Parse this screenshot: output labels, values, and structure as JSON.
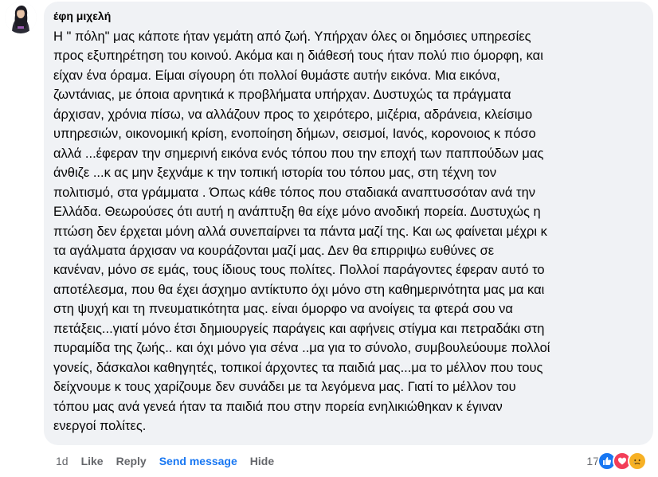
{
  "comment": {
    "author": "έφη μιχελή",
    "text": "Η \" πόλη\" μας κάποτε ήταν γεμάτη από ζωή. Υπήρχαν όλες οι δημόσιες υπηρεσίες\nπρος εξυπηρέτηση του κοινού. Ακόμα και η διάθεσή τους ήταν πολύ πιο όμορφη, και\nείχαν ένα όραμα. Είμαι σίγουρη ότι πολλοί θυμάστε αυτήν εικόνα. Μια εικόνα,\nζωντάνιας, με όποια αρνητικά κ προβλήματα υπήρχαν. Δυστυχώς τα πράγματα\nάρχισαν, χρόνια πίσω, να αλλάζουν προς το χειρότερο, μιζέρια, αδράνεια, κλείσιμο\nυπηρεσιών, οικονομική κρίση, ενοποίηση δήμων, σεισμοί, Ιανός, κορονοιος κ πόσο\nαλλά ...έφεραν την σημερινή εικόνα ενός τόπου που την εποχή των παππούδων μας\nάνθιζε ...κ ας μην ξεχνάμε κ την τοπική ιστορία του τόπου μας, στη τέχνη τον\nπολιτισμό, στα γράμματα . Όπως κάθε τόπος που σταδιακά αναπτυσσόταν ανά την\nΕλλάδα. Θεωρούσες ότι αυτή η ανάπτυξη θα είχε μόνο ανοδική πορεία. Δυστυχώς η\nπτώση δεν έρχεται μόνη αλλά συνεπαίρνει τα πάντα μαζί της. Και ως φαίνεται μέχρι κ\nτα αγάλματα άρχισαν να κουράζονται μαζί μας. Δεν θα επιρριψω ευθύνες σε\nκανέναν, μόνο σε εμάς, τους ίδιους τους πολίτες. Πολλοί παράγοντες έφεραν αυτό το\nαποτέλεσμα, που θα έχει άσχημο αντίκτυπο όχι μόνο στη καθημερινότητα μας μα και\nστη ψυχή και τη πνευματικότητα μας. είναι όμορφο να ανοίγεις τα φτερά σου να\nπετάξεις...γιατί μόνο έτσι δημιουργείς παράγεις και αφήνεις στίγμα και πετραδάκι στη\nπυραμίδα της ζωής.. και όχι μόνο για σένα ..μα για το σύνολο, συμβουλεύουμε πολλοί\nγονείς, δάσκαλοι καθηγητές, τοπικοί άρχοντες τα παιδιά μας...μα το μέλλον που τους\nδείχνουμε κ τους χαρίζουμε δεν συνάδει με τα λεγόμενα μας. Γιατί το μέλλον του\nτόπου μας ανά γενεά ήταν τα παιδιά που στην πορεία ενηλικιώθηκαν κ έγιναν\nενεργοί πολίτες."
  },
  "actions": {
    "time": "1d",
    "like": "Like",
    "reply": "Reply",
    "send_message": "Send message",
    "hide": "Hide"
  },
  "reactions": {
    "count": "17",
    "icons": [
      "like-icon",
      "love-icon",
      "sad-icon"
    ]
  },
  "colors": {
    "bubble": "#f0f2f5",
    "secondary_text": "#65676b",
    "link_blue": "#1877f2",
    "like_blue": "#1877f2",
    "love_red": "#f33e58",
    "sad_yellow": "#f7b125"
  }
}
